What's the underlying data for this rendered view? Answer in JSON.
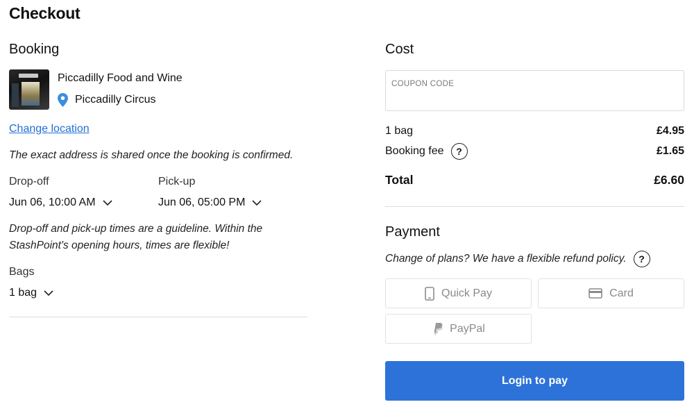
{
  "page": {
    "title": "Checkout"
  },
  "booking": {
    "title": "Booking",
    "store_name": "Piccadilly Food and Wine",
    "location_name": "Piccadilly Circus",
    "change_location": "Change location",
    "address_note": "The exact address is shared once the booking is confirmed.",
    "dropoff_label": "Drop-off",
    "dropoff_value": "Jun 06, 10:00 AM",
    "pickup_label": "Pick-up",
    "pickup_value": "Jun 06, 05:00 PM",
    "times_note": "Drop-off and pick-up times are a guideline. Within the StashPoint's opening hours, times are flexible!",
    "bags_label": "Bags",
    "bags_value": "1 bag"
  },
  "cost": {
    "title": "Cost",
    "coupon_placeholder": "COUPON CODE",
    "bag_label": "1 bag",
    "bag_amount": "£4.95",
    "fee_label": "Booking fee",
    "fee_amount": "£1.65",
    "total_label": "Total",
    "total_amount": "£6.60",
    "help_glyph": "?"
  },
  "payment": {
    "title": "Payment",
    "refund_note": "Change of plans? We have a flexible refund policy.",
    "methods": [
      {
        "label": "Quick Pay",
        "icon": "phone-icon"
      },
      {
        "label": "Card",
        "icon": "credit-card-icon"
      },
      {
        "label": "PayPal",
        "icon": "paypal-icon"
      }
    ],
    "login_button": "Login to pay"
  },
  "colors": {
    "accent": "#2d72d9",
    "link": "#1f6fd6",
    "pin": "#3b8de0",
    "divider": "#dcdcdc"
  }
}
